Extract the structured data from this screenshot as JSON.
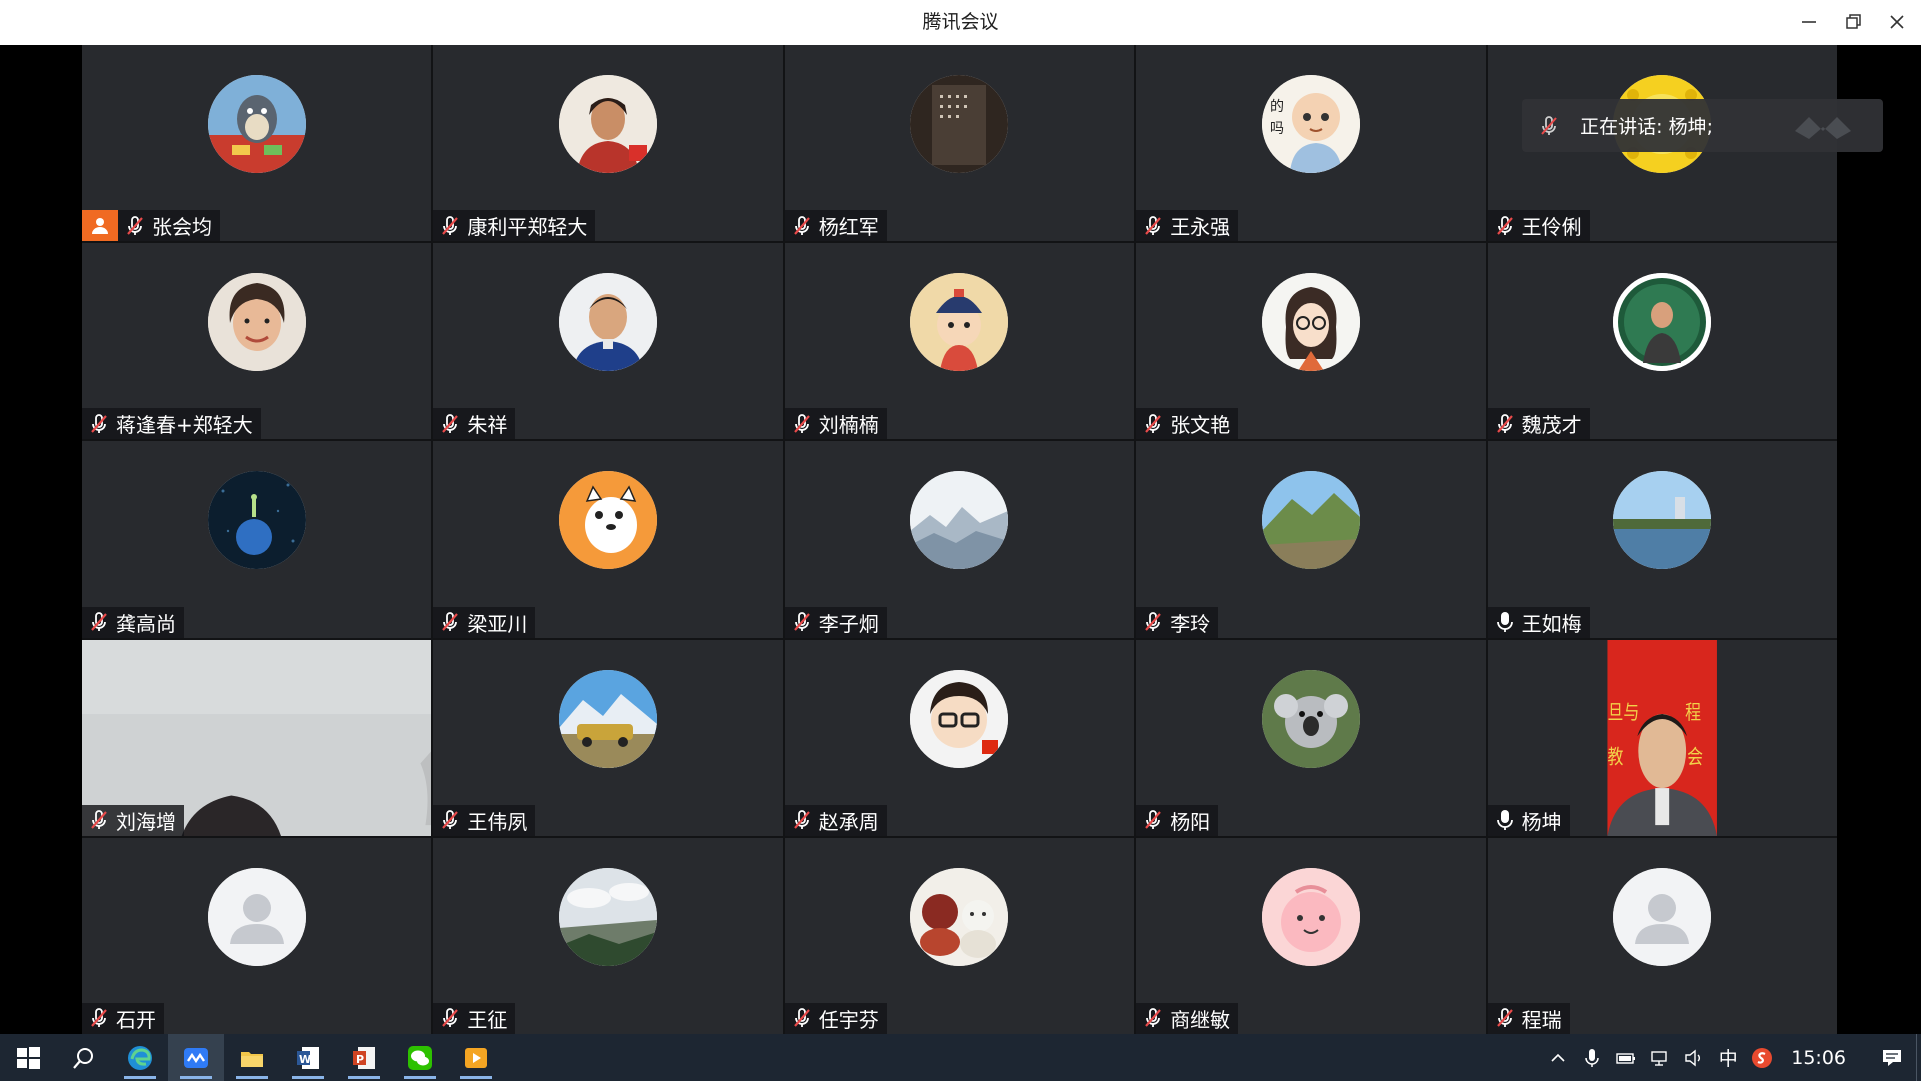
{
  "window": {
    "title": "腾讯会议"
  },
  "speaking_banner": {
    "text": "正在讲话: 杨坤;"
  },
  "participants": [
    {
      "name": "张会均",
      "mic": "muted",
      "host": true,
      "avatar": "totoro-cartoon-avatar"
    },
    {
      "name": "康利平郑轻大",
      "mic": "muted",
      "avatar": "woman-photo-avatar"
    },
    {
      "name": "杨红军",
      "mic": "muted",
      "avatar": "calligraphy-stone-avatar"
    },
    {
      "name": "王永强",
      "mic": "muted",
      "avatar": "cartoon-monk-avatar"
    },
    {
      "name": "王伶俐",
      "mic": "muted",
      "avatar": "yellow-sun-avatar"
    },
    {
      "name": "蒋逢春+郑轻大",
      "mic": "muted",
      "avatar": "woman-portrait-avatar"
    },
    {
      "name": "朱祥",
      "mic": "muted",
      "avatar": "man-portrait-avatar"
    },
    {
      "name": "刘楠楠",
      "mic": "muted",
      "avatar": "cartoon-child-avatar"
    },
    {
      "name": "张文艳",
      "mic": "muted",
      "avatar": "cartoon-glasses-girl-avatar"
    },
    {
      "name": "魏茂才",
      "mic": "muted",
      "avatar": "man-green-frame-avatar"
    },
    {
      "name": "龚高尚",
      "mic": "muted",
      "avatar": "planet-night-avatar"
    },
    {
      "name": "梁亚川",
      "mic": "muted",
      "avatar": "cartoon-cat-avatar"
    },
    {
      "name": "李子炯",
      "mic": "muted",
      "avatar": "misty-mountain-avatar"
    },
    {
      "name": "李玲",
      "mic": "muted",
      "avatar": "mountain-landscape-avatar"
    },
    {
      "name": "王如梅",
      "mic": "on",
      "avatar": "lake-landscape-avatar"
    },
    {
      "name": "刘海增",
      "mic": "muted",
      "video": "camera-feed-light"
    },
    {
      "name": "王伟夙",
      "mic": "muted",
      "avatar": "snow-mountain-car-avatar"
    },
    {
      "name": "赵承周",
      "mic": "muted",
      "avatar": "cartoon-glasses-man-avatar"
    },
    {
      "name": "杨阳",
      "mic": "muted",
      "avatar": "koala-avatar"
    },
    {
      "name": "杨坤",
      "mic": "on",
      "video": "camera-feed-speaker",
      "active_speaker": true
    },
    {
      "name": "石开",
      "mic": "muted",
      "avatar": "default-user-avatar"
    },
    {
      "name": "王征",
      "mic": "muted",
      "avatar": "cloudy-landscape-avatar"
    },
    {
      "name": "任宇芬",
      "mic": "muted",
      "avatar": "figurines-avatar"
    },
    {
      "name": "商继敏",
      "mic": "muted",
      "avatar": "pink-cartoon-avatar"
    },
    {
      "name": "程瑞",
      "mic": "muted",
      "avatar": "default-user-avatar"
    }
  ],
  "taskbar": {
    "apps": [
      {
        "name": "start-button",
        "icon": "windows-logo-icon"
      },
      {
        "name": "search-button",
        "icon": "search-icon"
      },
      {
        "name": "edge",
        "icon": "edge-icon",
        "open": true
      },
      {
        "name": "tencent-meeting",
        "icon": "tencent-meeting-icon",
        "open": true,
        "active": true
      },
      {
        "name": "file-explorer",
        "icon": "folder-icon",
        "open": true
      },
      {
        "name": "word",
        "icon": "word-icon",
        "open": true
      },
      {
        "name": "powerpoint",
        "icon": "powerpoint-icon",
        "open": true
      },
      {
        "name": "wechat",
        "icon": "wechat-icon",
        "open": true
      },
      {
        "name": "video-player",
        "icon": "video-player-icon",
        "open": true
      }
    ],
    "tray": {
      "ime": "中",
      "time": "15:06"
    }
  },
  "colors": {
    "tile_bg": "#282a2e",
    "active_speaker_border": "#27b36a",
    "host_badge": "#f06a22",
    "taskbar_bg": "#1d2632"
  }
}
